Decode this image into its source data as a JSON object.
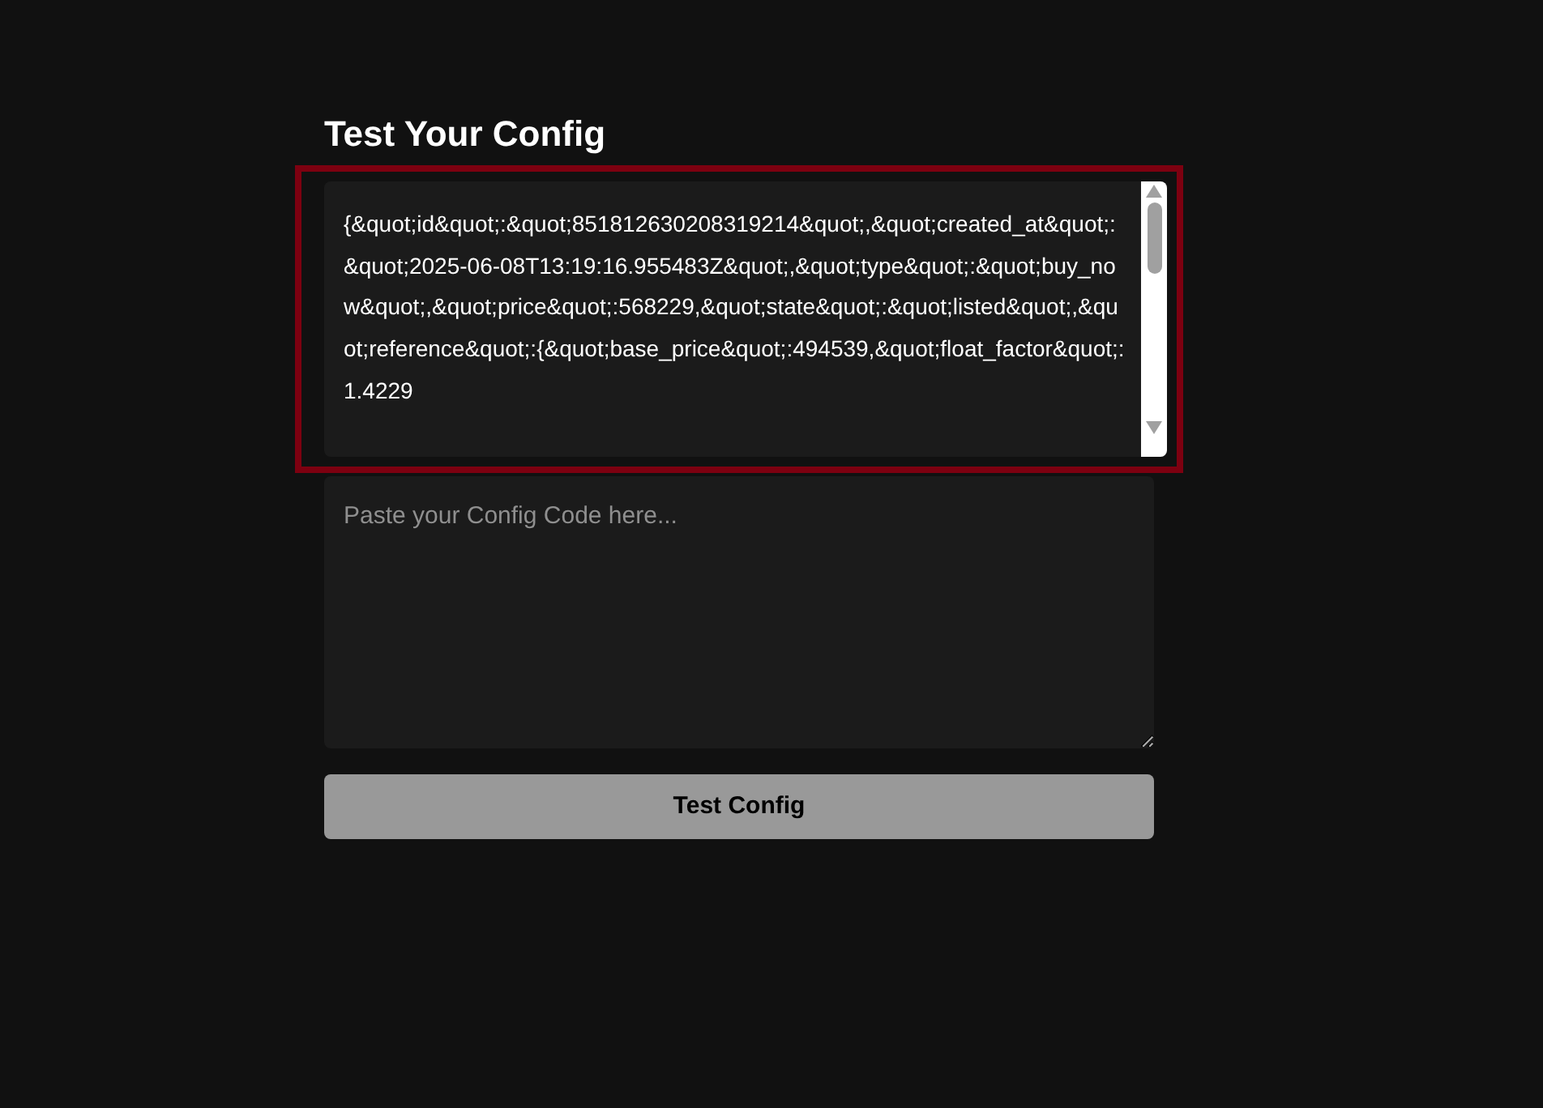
{
  "title": "Test Your Config",
  "config_output": {
    "value": "{&quot;id&quot;:&quot;851812630208319214&quot;,&quot;created_at&quot;:&quot;2025-06-08T13:19:16.955483Z&quot;,&quot;type&quot;:&quot;buy_now&quot;,&quot;price&quot;:568229,&quot;state&quot;:&quot;listed&quot;,&quot;reference&quot;:{&quot;base_price&quot;:494539,&quot;float_factor&quot;:1.4229"
  },
  "config_input": {
    "placeholder": "Paste your Config Code here..."
  },
  "test_button": {
    "label": "Test Config"
  }
}
